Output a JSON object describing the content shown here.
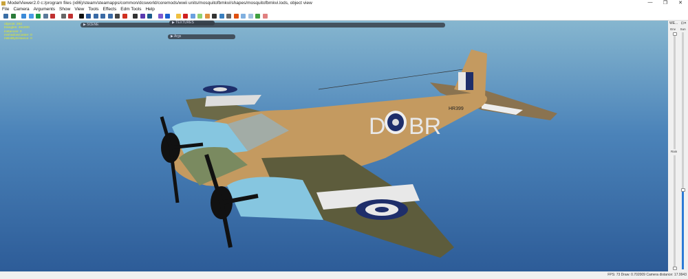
{
  "window": {
    "title": "ModelViewer2.0 c:/program files (x86)/steam/steamapps/common/dcsworld/coremods/wwii units/mosquitofbmkvi/shapes/mosquitofbmkvi.lods, object view",
    "minimize": "—",
    "maximize": "❐",
    "close": "✕"
  },
  "menu": [
    "File",
    "Camera",
    "Arguments",
    "Show",
    "View",
    "Tools",
    "Effects",
    "Edm Tools",
    "Help"
  ],
  "toolbar_colors": [
    "#3a6ea5",
    "#2a7b3a",
    "#3b8ad8",
    "#4a9be8",
    "#1a9a4a",
    "#5a7a9a",
    "#c03030",
    "#666",
    "#c03030",
    "#111",
    "#2a5a9a",
    "#3a6aa5",
    "#3a6aa5",
    "#3a6aa5",
    "#444",
    "#d03020",
    "#333",
    "#5a3ab0",
    "#1a5a8a",
    "#7a5ad0",
    "#1a60d0",
    "#f0c040",
    "#d02020",
    "#6aa0e0",
    "#90d070",
    "#e09040",
    "#333",
    "#3a80c0",
    "#666",
    "#e05010",
    "#80b0e0",
    "#a0c0e0",
    "#40a040",
    "#e08080"
  ],
  "stats": [
    "objects: 292",
    "triangles: 461000",
    "instances: 0",
    "mShadowCaster: 0",
    "mBotByDistance: 0"
  ],
  "panels": {
    "scene": "▶ SCENE",
    "textures": "▶ TEXTURES",
    "args": "▶ Args"
  },
  "right_panel": {
    "title": "WE...",
    "env": "Env",
    "sun": "Sun",
    "rain": "Rain",
    "env_value": 1.0,
    "sun_value": 0.0,
    "rain_value": 0.45
  },
  "aircraft": {
    "code": "D",
    "code2": "BR",
    "serial": "HR399"
  },
  "status": "FPS: 73   Draw: 0.702009   Camera distance: 17.9943"
}
